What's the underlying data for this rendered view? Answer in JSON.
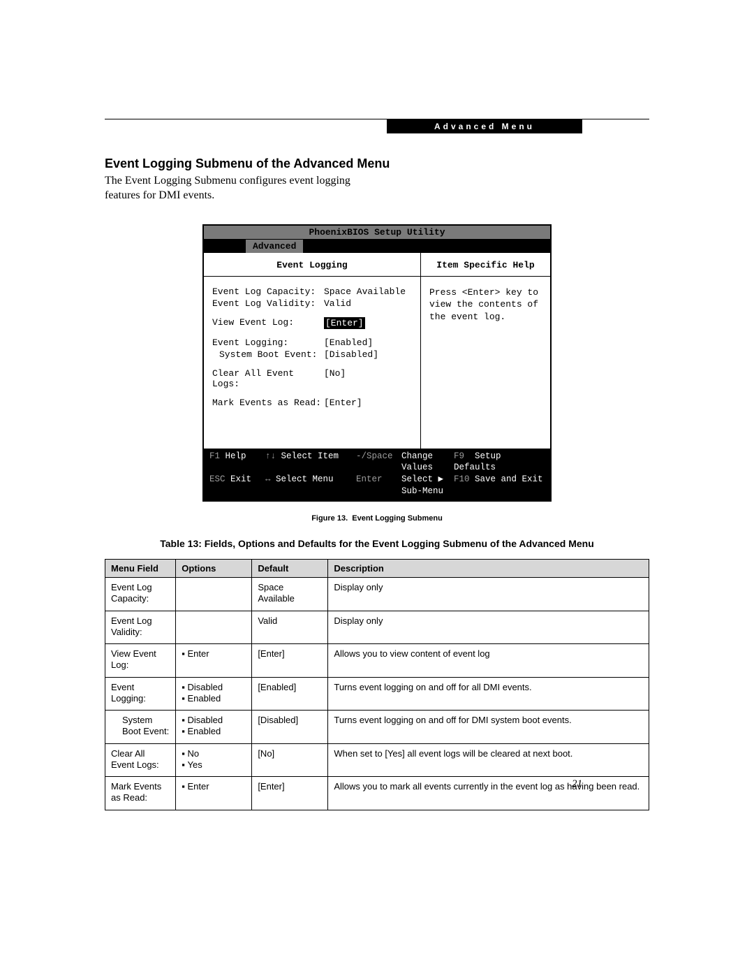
{
  "header_ribbon": "Advanced Menu",
  "section_title": "Event Logging Submenu of the Advanced Menu",
  "intro": "The Event Logging Submenu configures event logging features for DMI events.",
  "page_number": "21",
  "bios": {
    "title": "PhoenixBIOS Setup Utility",
    "tab": "Advanced",
    "left_pane_title": "Event Logging",
    "right_pane_title": "Item Specific Help",
    "help_text_l1": "Press <Enter> key to",
    "help_text_l2": "view the contents of",
    "help_text_l3": "the event log.",
    "rows": {
      "capacity_k": "Event Log Capacity:",
      "capacity_v": "Space Available",
      "validity_k": "Event Log Validity:",
      "validity_v": "Valid",
      "view_k": "View Event Log:",
      "view_v": "[Enter]",
      "logging_k": "Event Logging:",
      "logging_v": "[Enabled]",
      "sysboot_k": "System Boot Event:",
      "sysboot_v": "[Disabled]",
      "clear_k": "Clear All Event Logs:",
      "clear_v": "[No]",
      "mark_k": "Mark Events as Read:",
      "mark_v": "[Enter]"
    },
    "footer": {
      "f1": "F1",
      "help": "Help",
      "ud": "↑↓",
      "select_item": "Select Item",
      "chg_key": "-/Space",
      "chg_label": "Change Values",
      "f9": "F9",
      "setup_defaults": "Setup Defaults",
      "esc": "ESC",
      "exit": "Exit",
      "lr": "↔",
      "select_menu": "Select Menu",
      "enter": "Enter",
      "select_sub": "Select ▶ Sub-Menu",
      "f10": "F10",
      "save_exit": "Save and Exit"
    }
  },
  "caption": "Figure 13.  Event Logging Submenu",
  "table_title": "Table 13: Fields, Options and Defaults for the Event Logging Submenu of the Advanced Menu",
  "table": {
    "h_field": "Menu Field",
    "h_options": "Options",
    "h_default": "Default",
    "h_desc": "Description",
    "rows": [
      {
        "field": "Event Log Capacity:",
        "options": [],
        "default": "Space Available",
        "desc": "Display only",
        "indent": false
      },
      {
        "field": "Event Log Validity:",
        "options": [],
        "default": "Valid",
        "desc": "Display only",
        "indent": false
      },
      {
        "field": "View Event Log:",
        "options": [
          "Enter"
        ],
        "default": "[Enter]",
        "desc": "Allows you to view content of event log",
        "indent": false
      },
      {
        "field": "Event Logging:",
        "options": [
          "Disabled",
          "Enabled"
        ],
        "default": "[Enabled]",
        "desc": "Turns event logging on and off for all DMI events.",
        "indent": false
      },
      {
        "field": "System Boot Event:",
        "options": [
          "Disabled",
          "Enabled"
        ],
        "default": "[Disabled]",
        "desc": "Turns event logging on and off for DMI system boot events.",
        "indent": true
      },
      {
        "field": "Clear All Event Logs:",
        "options": [
          "No",
          "Yes"
        ],
        "default": "[No]",
        "desc": "When set to [Yes] all event logs will be cleared at next boot.",
        "indent": false
      },
      {
        "field": "Mark Events as Read:",
        "options": [
          "Enter"
        ],
        "default": "[Enter]",
        "desc": "Allows you to mark all events currently in the event log as having been read.",
        "indent": false
      }
    ]
  }
}
